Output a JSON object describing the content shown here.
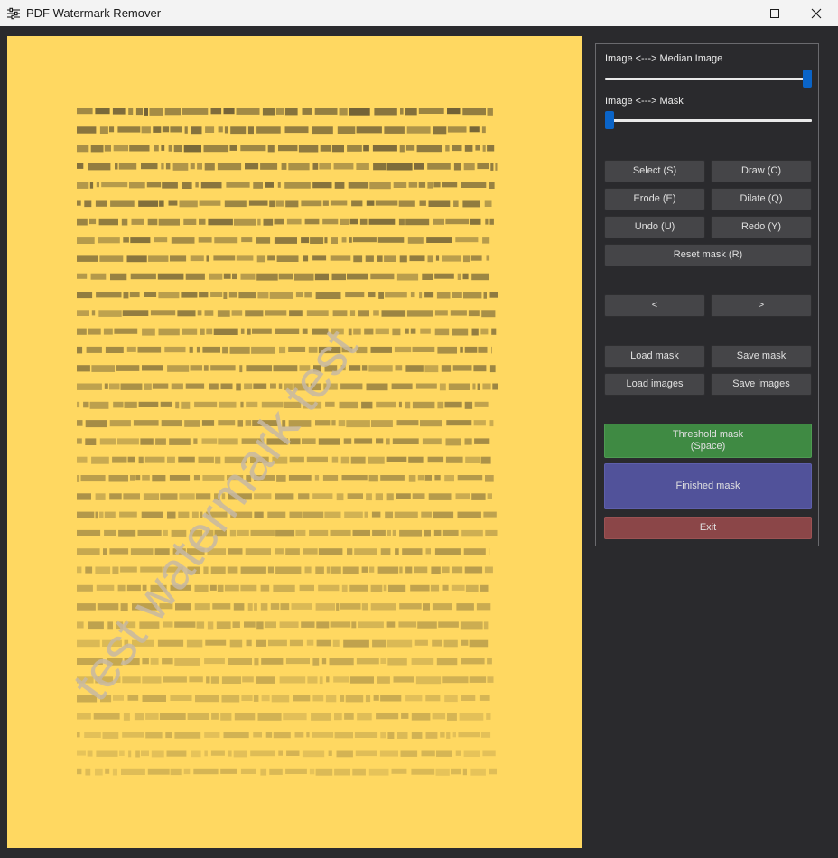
{
  "window": {
    "title": "PDF Watermark Remover",
    "icon": "sliders-icon",
    "controls": [
      "minimize-icon",
      "maximize-icon",
      "close-icon"
    ]
  },
  "preview": {
    "background_color": "#ffd861",
    "watermark_text": "test watermark test"
  },
  "sliders": {
    "median": {
      "label": "Image <---> Median Image",
      "value_fraction": 1.0
    },
    "mask": {
      "label": "Image <---> Mask",
      "value_fraction": 0.0
    }
  },
  "buttons": {
    "select": "Select (S)",
    "draw": "Draw (C)",
    "erode": "Erode (E)",
    "dilate": "Dilate (Q)",
    "undo": "Undo (U)",
    "redo": "Redo (Y)",
    "reset_mask": "Reset mask (R)",
    "prev": "<",
    "next": ">",
    "load_mask": "Load mask",
    "save_mask": "Save mask",
    "load_images": "Load images",
    "save_images": "Save images",
    "threshold_mask": "Threshold mask\n(Space)",
    "finished_mask": "Finished mask",
    "exit": "Exit"
  },
  "colors": {
    "accent_blue": "#0a64c8",
    "threshold_green": "#3f8a43",
    "finished_blue": "#51529a",
    "exit_red": "#8b4648"
  }
}
